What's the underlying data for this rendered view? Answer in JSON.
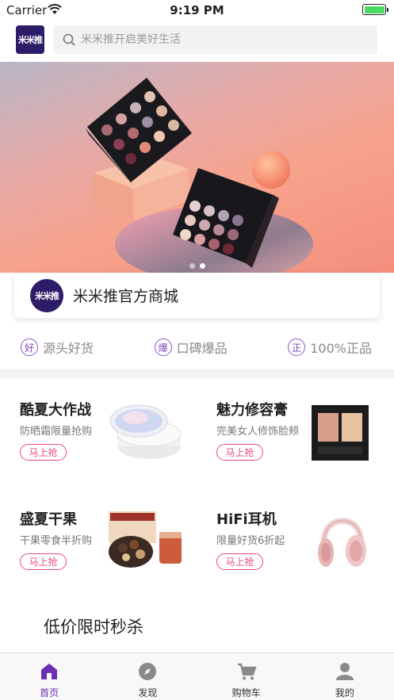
{
  "status_bar": {
    "carrier": "Carrier",
    "time": "9:19 PM"
  },
  "header": {
    "logo_text": "米米推",
    "search_placeholder": "米米推开启美好生活"
  },
  "banner": {
    "dots": 2,
    "active_dot": 1
  },
  "shop": {
    "avatar_text": "米米推",
    "name": "米米推官方商城"
  },
  "features": [
    {
      "badge": "好",
      "label": "源头好货"
    },
    {
      "badge": "爆",
      "label": "口碑爆品"
    },
    {
      "badge": "正",
      "label": "100%正品"
    }
  ],
  "promos": [
    {
      "title": "酷夏大作战",
      "subtitle": "防晒霜限量抢购",
      "button": "马上抢"
    },
    {
      "title": "魅力修容膏",
      "subtitle": "完美女人修饰脸颊",
      "button": "马上抢"
    },
    {
      "title": "盛夏干果",
      "subtitle": "干果零食半折购",
      "button": "马上抢"
    },
    {
      "title": "HiFi耳机",
      "subtitle": "限量好货6折起",
      "button": "马上抢"
    }
  ],
  "flash_sale": {
    "title": "低价限时秒杀"
  },
  "tabbar": [
    {
      "label": "首页",
      "icon": "home-icon",
      "active": true
    },
    {
      "label": "发现",
      "icon": "compass-icon",
      "active": false
    },
    {
      "label": "购物车",
      "icon": "cart-icon",
      "active": false
    },
    {
      "label": "我的",
      "icon": "user-icon",
      "active": false
    }
  ],
  "colors": {
    "brand": "#2d1d69",
    "accent": "#6c2fb3",
    "button": "#e84a7f"
  }
}
